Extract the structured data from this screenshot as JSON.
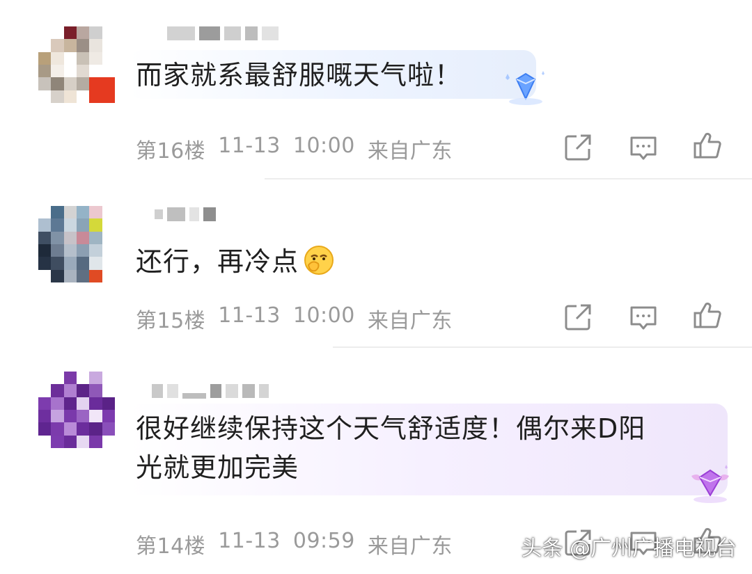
{
  "comments": [
    {
      "text": "而家就系最舒服嘅天气啦！",
      "floor": "第16楼",
      "date": "11-13",
      "time": "10:00",
      "location": "来自广东"
    },
    {
      "text": "还行，再冷点",
      "floor": "第15楼",
      "date": "11-13",
      "time": "10:00",
      "location": "来自广东"
    },
    {
      "text_line1": "很好继续保持这个天气舒适度！偶尔来D阳",
      "text_line2": "光就更加完美",
      "floor": "第14楼",
      "date": "11-13",
      "time": "09:59",
      "location": "来自广东"
    }
  ],
  "icons": {
    "share": "share-icon",
    "reply": "reply-icon",
    "like": "thumbs-up-icon",
    "badge_blue": "diamond-badge-blue-icon",
    "badge_purple": "diamond-badge-purple-icon",
    "emoji": "smirk-emoji-icon"
  },
  "colors": {
    "meta_text": "#9a9a9a",
    "bubble_blue": "#e6eefc",
    "bubble_purple": "#efe6fb"
  },
  "watermark": "头条 @广州广播电视台"
}
